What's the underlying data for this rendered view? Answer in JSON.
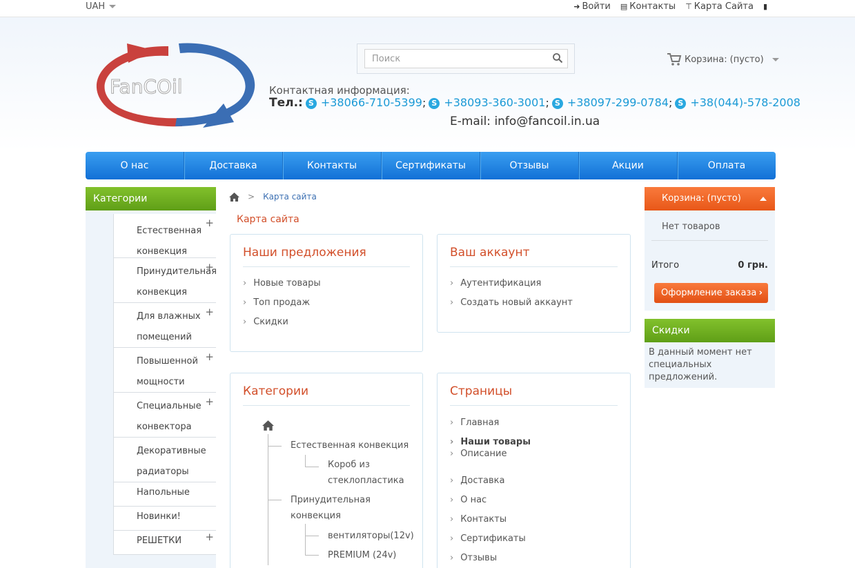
{
  "topbar": {
    "currency": "UAH",
    "links": [
      {
        "icon": "sign-in-icon",
        "label": "Войти"
      },
      {
        "icon": "document-icon",
        "label": "Контакты"
      },
      {
        "icon": "sitemap-icon",
        "label": "Карта Сайта"
      },
      {
        "icon": "bookmark-icon",
        "label": ""
      }
    ]
  },
  "header": {
    "logo_text": "FanCOil",
    "search_placeholder": "Поиск",
    "cart_label": "Корзина:",
    "cart_status": "(пусто)",
    "contact_title": "Контактная информация:",
    "phone_label": "Тел.:",
    "phones": [
      "+38066-710-5399",
      "+38093-360-3001",
      "+38097-299-0784",
      "+38(044)-578-2008"
    ],
    "email_label": "E-mail:",
    "email": "info@fancoil.in.ua"
  },
  "nav": [
    "О нас",
    "Доставка",
    "Контакты",
    "Сертификаты",
    "Отзывы",
    "Акции",
    "Оплата"
  ],
  "sidebar": {
    "title": "Категории",
    "items": [
      {
        "line1": "Естественная",
        "line2": "конвекция",
        "plus": "+"
      },
      {
        "line1": "Принудительная",
        "line2": "конвекция",
        "plus": "+"
      },
      {
        "line1": "Для влажных",
        "line2": "помещений",
        "plus": "+"
      },
      {
        "line1": "Повышенной",
        "line2": "мощности",
        "plus": "+"
      },
      {
        "line1": "Специальные",
        "line2": "конвектора",
        "plus": "+"
      },
      {
        "line1": "Декоративные",
        "line2": "радиаторы",
        "plus": ""
      },
      {
        "line1": "Напольные",
        "line2": "",
        "plus": ""
      },
      {
        "line1": "Новинки!",
        "line2": "",
        "plus": ""
      },
      {
        "line1": "РЕШЕТКИ",
        "line2": "",
        "plus": "+"
      }
    ]
  },
  "breadcrumb": {
    "separator": ">",
    "current": "Карта сайта"
  },
  "page_title": "Карта сайта",
  "offers": {
    "title": "Наши предложения",
    "items": [
      "Новые товары",
      "Топ продаж",
      "Скидки"
    ]
  },
  "account": {
    "title": "Ваш аккаунт",
    "items": [
      "Аутентификация",
      "Создать новый аккаунт"
    ]
  },
  "categories_box": {
    "title": "Категории",
    "l1a": "Естественная конвекция",
    "l2a_1": "Короб из",
    "l2a_2": "стеклопластика",
    "l1b_1": "Принудительная",
    "l1b_2": "конвекция",
    "l2b": "вентиляторы(12v)",
    "l2c": "PREMIUM (24v)"
  },
  "pages_box": {
    "title": "Страницы",
    "items": [
      "Главная",
      "Наши товары",
      "Описание",
      "Доставка",
      "О нас",
      "Контакты",
      "Сертификаты",
      "Отзывы"
    ]
  },
  "cart_box": {
    "title": "Корзина:",
    "status": "(пусто)",
    "empty": "Нет товаров",
    "total_label": "Итого",
    "total_value": "0 грн.",
    "checkout": "Оформление заказа"
  },
  "discounts": {
    "title": "Скидки",
    "text": "В данный момент нет специальных предложений."
  },
  "colors": {
    "nav": "#1a7fe0",
    "accent_orange": "#e85718",
    "accent_green": "#6aae1e",
    "title_red": "#d24f2a",
    "link_blue": "#1b9ad6"
  }
}
